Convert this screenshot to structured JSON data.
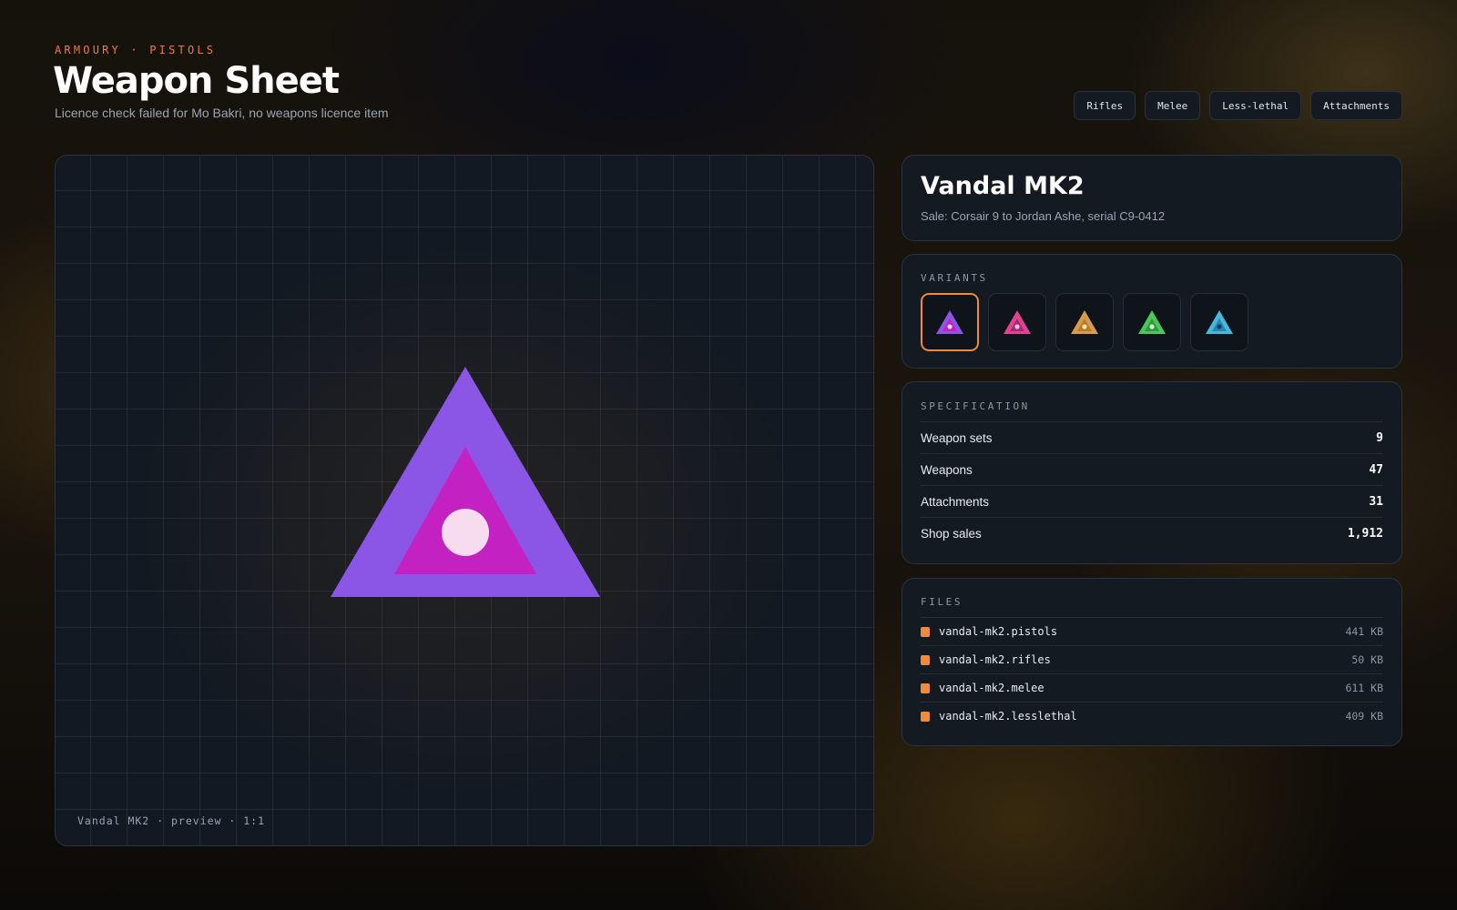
{
  "header": {
    "eyebrow": "ARMOURY · PISTOLS",
    "title": "Weapon Sheet",
    "subtitle": "Licence check failed for Mo Bakri, no weapons licence item"
  },
  "nav": [
    {
      "label": "Rifles"
    },
    {
      "label": "Melee"
    },
    {
      "label": "Less-lethal"
    },
    {
      "label": "Attachments"
    }
  ],
  "preview": {
    "caption": "Vandal MK2 · preview · 1:1",
    "icon": "triangle-emblem-icon",
    "colors": {
      "outer": "#8b55e6",
      "inner": "#c421c2",
      "dot": "#f7dcef"
    }
  },
  "item": {
    "name": "Vandal MK2",
    "sale": "Sale: Corsair 9 to Jordan Ashe, serial C9-0412"
  },
  "variants": {
    "label": "VARIANTS",
    "selected_index": 0,
    "items": [
      {
        "icon": "triangle-emblem-icon",
        "outer": "#8b55e6",
        "inner": "#c421c2",
        "dot": "#f7dcef"
      },
      {
        "icon": "triangle-emblem-icon",
        "outer": "#e0438f",
        "inner": "#a32b72",
        "dot": "#f7c6dc"
      },
      {
        "icon": "triangle-emblem-icon",
        "outer": "#d99a4b",
        "inner": "#b97a2e",
        "dot": "#f3e3b0"
      },
      {
        "icon": "triangle-emblem-icon",
        "outer": "#4cc65a",
        "inner": "#2f9a3f",
        "dot": "#d6f5c8"
      },
      {
        "icon": "triangle-emblem-icon",
        "outer": "#47b8dd",
        "inner": "#2b86ad",
        "dot": "#1f3e5e"
      }
    ]
  },
  "specification": {
    "label": "SPECIFICATION",
    "rows": [
      {
        "key": "Weapon sets",
        "value": "9"
      },
      {
        "key": "Weapons",
        "value": "47"
      },
      {
        "key": "Attachments",
        "value": "31"
      },
      {
        "key": "Shop sales",
        "value": "1,912"
      }
    ]
  },
  "files": {
    "label": "FILES",
    "accent": "#f08a3c",
    "rows": [
      {
        "name": "vandal-mk2.pistols",
        "size": "441 KB"
      },
      {
        "name": "vandal-mk2.rifles",
        "size": "50 KB"
      },
      {
        "name": "vandal-mk2.melee",
        "size": "611 KB"
      },
      {
        "name": "vandal-mk2.lesslethal",
        "size": "409 KB"
      }
    ]
  }
}
